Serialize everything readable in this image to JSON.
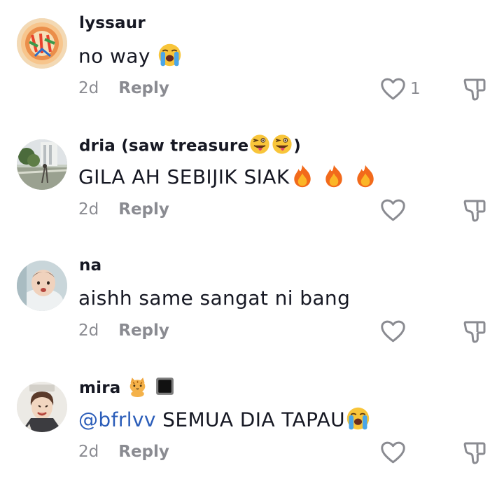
{
  "comments": [
    {
      "username": "lyssaur",
      "text": "no way",
      "time": "2d",
      "reply_label": "Reply",
      "like_count": "1"
    },
    {
      "username": "dria  (saw  treasure",
      "username_suffix": ")",
      "text": "GILA AH SEBIJIK SIAK",
      "time": "2d",
      "reply_label": "Reply"
    },
    {
      "username": "na",
      "text": "aishh same sangat ni bang",
      "time": "2d",
      "reply_label": "Reply"
    },
    {
      "username": "mira",
      "mention": "@bfrlvv",
      "text": " SEMUA DIA TAPAU",
      "time": "2d",
      "reply_label": "Reply"
    }
  ],
  "icons": {
    "like": "heart-outline-icon",
    "dislike": "thumbs-down-icon",
    "crying_emoji": "loudly-crying-face-emoji",
    "tongue_emoji": "winking-tongue-face-emoji",
    "fire_emoji": "fire-emoji",
    "cat_emoji": "tiger-cat-emoji",
    "square_emoji": "black-square-emoji"
  },
  "colors": {
    "text": "#161823",
    "muted": "#8a8b91",
    "mention": "#2b5db9"
  }
}
